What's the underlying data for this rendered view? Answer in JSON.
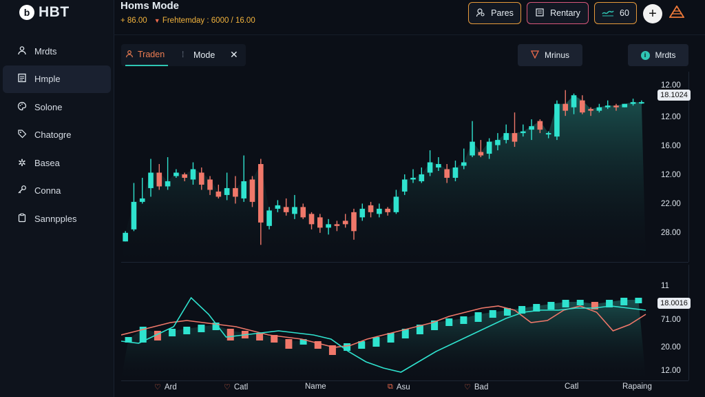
{
  "app": {
    "logo_mark": "b",
    "logo_text": "HBT"
  },
  "header": {
    "title": "Homs Mode",
    "change": "+ 86.00",
    "caret": "▼",
    "session": "Frehtemday",
    "range": ": 6000 / 16.00"
  },
  "top_buttons": {
    "pares": "Pares",
    "rentary": "Rentary",
    "sixty": "60",
    "plus": "+",
    "warn": "▲"
  },
  "sidebar": {
    "items": [
      {
        "label": "Mrdts",
        "icon": "user-icon"
      },
      {
        "label": "Hmple",
        "icon": "document-icon"
      },
      {
        "label": "Solone",
        "icon": "palette-icon"
      },
      {
        "label": "Chatogre",
        "icon": "tag-icon"
      },
      {
        "label": "Basea",
        "icon": "gear-icon"
      },
      {
        "label": "Conna",
        "icon": "key-icon"
      },
      {
        "label": "Sannpples",
        "icon": "clipboard-icon"
      }
    ]
  },
  "tabs": {
    "active": "Traden",
    "mode": "Mode",
    "sep": "⁞",
    "close": "✕"
  },
  "pills": {
    "minus": "Mrinus",
    "meds": "Mrdts",
    "meds_icon": "i"
  },
  "colors": {
    "up": "#2fe3cf",
    "down": "#f0786a",
    "area": "#1d5c58",
    "accent": "#ee7d52"
  },
  "y_axis_main": {
    "box": "18.1024",
    "labels": [
      "12.00",
      "12.00",
      "16.00",
      "12.00",
      "22.00",
      "28.00"
    ]
  },
  "y_axis_ind": {
    "top": "11",
    "box": "18.0016",
    "labels": [
      "71.00",
      "20.00",
      "12.00"
    ]
  },
  "bottom_labels": [
    {
      "text": "Ard",
      "icon": "heart-icon"
    },
    {
      "text": "Catl",
      "icon": "heart-icon"
    },
    {
      "text": "Name",
      "icon": ""
    },
    {
      "text": "Asu",
      "icon": "box-icon"
    },
    {
      "text": "Bad",
      "icon": "heart-icon"
    },
    {
      "text": "Catl",
      "icon": ""
    },
    {
      "text": "Rapaing",
      "icon": ""
    }
  ],
  "chart_data": {
    "type": "candlestick",
    "candles": [
      [
        -1.0,
        -0.5,
        -1.0,
        -0.4
      ],
      [
        -0.3,
        1.3,
        2.4,
        -0.4
      ],
      [
        1.3,
        1.5,
        2.7,
        1.2
      ],
      [
        2.1,
        3.0,
        3.8,
        1.6
      ],
      [
        3.0,
        2.2,
        3.5,
        2.0
      ],
      [
        2.2,
        2.5,
        3.9,
        2.0
      ],
      [
        2.8,
        3.0,
        3.2,
        2.7
      ],
      [
        2.9,
        2.7,
        3.0,
        2.5
      ],
      [
        2.6,
        3.2,
        3.6,
        2.3
      ],
      [
        3.0,
        2.3,
        3.3,
        2.0
      ],
      [
        2.6,
        2.0,
        2.8,
        1.7
      ],
      [
        1.9,
        1.6,
        2.3,
        1.5
      ],
      [
        1.7,
        2.1,
        3.0,
        1.4
      ],
      [
        2.1,
        1.6,
        2.8,
        1.2
      ],
      [
        1.5,
        2.5,
        4.0,
        1.3
      ],
      [
        2.6,
        1.3,
        2.8,
        1.0
      ],
      [
        3.5,
        0.1,
        3.8,
        -1.2
      ],
      [
        -0.1,
        0.8,
        1.0,
        -0.3
      ],
      [
        0.9,
        1.1,
        1.4,
        0.7
      ],
      [
        1.0,
        0.7,
        1.5,
        0.5
      ],
      [
        0.6,
        1.0,
        1.7,
        0.3
      ],
      [
        1.0,
        0.4,
        1.2,
        0.3
      ],
      [
        0.6,
        0.0,
        0.7,
        -0.3
      ],
      [
        0.4,
        -0.2,
        0.6,
        -0.5
      ],
      [
        -0.2,
        0.0,
        0.3,
        -0.6
      ],
      [
        0.0,
        -0.1,
        0.2,
        -0.4
      ],
      [
        0.2,
        0.0,
        0.6,
        -0.2
      ],
      [
        0.7,
        -0.4,
        0.9,
        -0.9
      ],
      [
        0.4,
        0.9,
        1.2,
        0.2
      ],
      [
        1.1,
        0.7,
        1.3,
        0.4
      ],
      [
        0.6,
        0.9,
        1.2,
        0.4
      ],
      [
        0.9,
        0.7,
        1.0,
        0.5
      ],
      [
        0.7,
        1.6,
        2.0,
        0.6
      ],
      [
        1.9,
        2.6,
        2.9,
        1.7
      ],
      [
        2.6,
        2.7,
        3.2,
        2.4
      ],
      [
        2.5,
        2.9,
        3.3,
        2.4
      ],
      [
        3.0,
        3.6,
        4.3,
        2.8
      ],
      [
        3.3,
        3.5,
        3.9,
        3.1
      ],
      [
        3.2,
        2.7,
        3.5,
        2.4
      ],
      [
        2.7,
        3.3,
        3.7,
        2.5
      ],
      [
        3.4,
        3.6,
        4.4,
        3.2
      ],
      [
        4.0,
        4.8,
        6.0,
        3.9
      ],
      [
        4.2,
        4.0,
        4.9,
        3.9
      ],
      [
        4.1,
        4.8,
        5.0,
        3.8
      ],
      [
        4.6,
        4.9,
        5.3,
        4.3
      ],
      [
        4.9,
        5.3,
        5.8,
        4.7
      ],
      [
        5.3,
        4.8,
        6.5,
        4.5
      ],
      [
        5.3,
        5.4,
        5.8,
        5.1
      ],
      [
        5.5,
        5.7,
        6.1,
        4.9
      ],
      [
        6.0,
        5.5,
        6.1,
        5.3
      ],
      [
        5.3,
        5.3,
        5.4,
        5.0
      ],
      [
        5.1,
        7.0,
        7.2,
        4.9
      ],
      [
        7.0,
        6.6,
        7.8,
        6.3
      ],
      [
        6.8,
        7.5,
        7.6,
        6.4
      ],
      [
        7.2,
        6.5,
        7.5,
        6.4
      ],
      [
        6.7,
        6.6,
        6.8,
        6.3
      ],
      [
        6.6,
        6.8,
        7.0,
        6.5
      ],
      [
        6.8,
        6.9,
        7.2,
        6.7
      ],
      [
        6.9,
        6.8,
        7.0,
        6.6
      ],
      [
        6.8,
        7.0,
        7.0,
        6.8
      ],
      [
        7.0,
        7.1,
        7.3,
        6.9
      ],
      [
        7.1,
        7.1,
        7.2,
        7.0
      ]
    ],
    "indicator": {
      "line_cyan": [
        0.1,
        0.0,
        0.4,
        0.8,
        2.2,
        1.4,
        0.3,
        0.4,
        0.5,
        0.6,
        0.5,
        0.4,
        0.2,
        -0.4,
        -0.9,
        -1.2,
        -1.4,
        -0.9,
        -0.4,
        0.0,
        0.4,
        0.8,
        1.2,
        1.5,
        1.6,
        1.6,
        1.7,
        1.7,
        1.8,
        1.7,
        1.6
      ],
      "line_red": [
        0.4,
        0.6,
        0.8,
        1.0,
        1.1,
        1.0,
        0.9,
        0.8,
        0.6,
        0.4,
        0.3,
        0.2,
        0.0,
        -0.2,
        -0.1,
        0.2,
        0.4,
        0.6,
        0.8,
        1.0,
        1.3,
        1.5,
        1.7,
        1.8,
        1.6,
        1.0,
        1.1,
        1.6,
        1.8,
        1.5,
        0.6,
        0.9,
        1.4
      ],
      "bars": [
        0.2,
        0.7,
        0.5,
        0.6,
        0.7,
        0.8,
        0.9,
        0.6,
        0.5,
        0.4,
        0.3,
        0.1,
        0.1,
        0.0,
        -0.2,
        -0.1,
        0.0,
        0.2,
        0.4,
        0.6,
        0.8,
        1.0,
        1.1,
        1.2,
        1.4,
        1.5,
        1.6,
        1.7,
        1.8,
        1.9,
        2.0,
        2.0,
        1.9,
        2.0,
        2.1,
        2.1
      ]
    }
  }
}
